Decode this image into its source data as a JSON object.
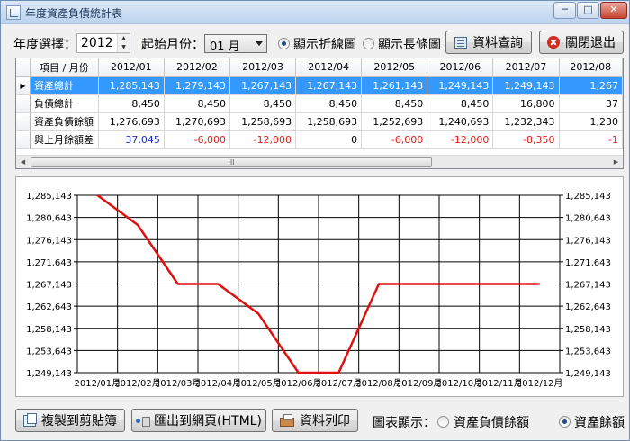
{
  "window": {
    "title": "年度資產負債統計表",
    "min": "─",
    "max": "□",
    "close": "✕"
  },
  "toolbar": {
    "year_label": "年度選擇：",
    "year_value": "2012",
    "start_month_label": "起始月份：",
    "start_month_value": "01 月",
    "radio_line": "顯示折線圖",
    "radio_bar": "顯示長條圖",
    "query_button": "資料查詢",
    "close_button": "關閉退出"
  },
  "grid": {
    "header_item": "項目 / 月份",
    "months": [
      "2012/01",
      "2012/02",
      "2012/03",
      "2012/04",
      "2012/05",
      "2012/06",
      "2012/07",
      "2012/08"
    ],
    "rows": [
      {
        "name": "資產總計",
        "values": [
          "1,285,143",
          "1,279,143",
          "1,267,143",
          "1,267,143",
          "1,261,143",
          "1,249,143",
          "1,249,143",
          "1,267"
        ]
      },
      {
        "name": "負債總計",
        "values": [
          "8,450",
          "8,450",
          "8,450",
          "8,450",
          "8,450",
          "8,450",
          "16,800",
          "37"
        ]
      },
      {
        "name": "資產負債餘額",
        "values": [
          "1,276,693",
          "1,270,693",
          "1,258,693",
          "1,258,693",
          "1,252,693",
          "1,240,693",
          "1,232,343",
          "1,230"
        ]
      },
      {
        "name": "與上月餘額差",
        "values": [
          "37,045",
          "-6,000",
          "-12,000",
          "0",
          "-6,000",
          "-12,000",
          "-8,350",
          "-1"
        ]
      }
    ],
    "scroll_grip": "III"
  },
  "chart_data": {
    "type": "line",
    "title": "",
    "xlabel": "",
    "ylabel": "",
    "categories": [
      "2012/01月",
      "2012/02月",
      "2012/03月",
      "2012/04月",
      "2012/05月",
      "2012/06月",
      "2012/07月",
      "2012/08月",
      "2012/09月",
      "2012/10月",
      "2012/11月",
      "2012/12月"
    ],
    "series": [
      {
        "values": [
          1285143,
          1279143,
          1267143,
          1267143,
          1261143,
          1249143,
          1249143,
          1267143,
          1267143,
          1267143,
          1267143,
          1267143
        ]
      }
    ],
    "ylim": [
      1249143,
      1285143
    ],
    "yticks": [
      1285143,
      1280643,
      1276143,
      1271643,
      1267143,
      1262643,
      1258143,
      1253643,
      1249143
    ],
    "ytick_labels": [
      "1,285,143",
      "1,280,643",
      "1,276,143",
      "1,271,643",
      "1,267,143",
      "1,262,643",
      "1,258,143",
      "1,253,643",
      "1,249,143"
    ],
    "grid": true,
    "line_color": "#e01010",
    "grid_color": "#000000"
  },
  "bottom": {
    "copy_button": "複製到剪貼簿",
    "export_button": "匯出到網頁(HTML)",
    "print_button": "資料列印",
    "chart_show_label": "圖表顯示：",
    "radio_balance": "資產負債餘額",
    "radio_assets": "資產餘額"
  }
}
